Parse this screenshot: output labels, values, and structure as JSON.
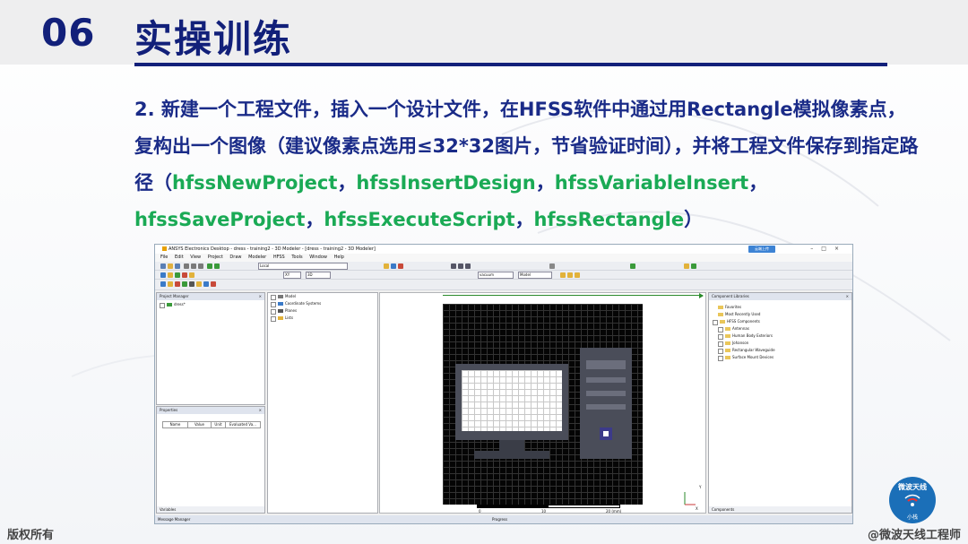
{
  "slide": {
    "section_number": "06",
    "section_title": "实操训练",
    "para_prefix": "2. 新建一个工程文件，插入一个设计文件，在HFSS软件中通过用Rectangle模拟像素点，复构出一个图像（建议像素点选用≤32*32图片，节省验证时间），并将工程文件保存到指定路径（",
    "functions": [
      "hfssNewProject",
      "hfssInsertDesign",
      "hfssVariableInsert",
      "hfssSaveProject",
      "hfssExecuteScript",
      "hfssRectangle"
    ],
    "sep1": "，",
    "sep2": "，",
    "sep3": "，",
    "sep4": "，",
    "sep5": "，",
    "para_suffix": "）",
    "footer_left": "版权所有",
    "footer_right": "@微波天线工程师",
    "badge_top": "微波天线",
    "badge_bottom": "小栈"
  },
  "window": {
    "title": "ANSYS Electronics Desktop - dress - training2 - 3D Modeler - [dress - training2 - 3D Modeler]",
    "cloud_button": "云端上传",
    "menu": [
      "File",
      "Edit",
      "View",
      "Project",
      "Draw",
      "Modeler",
      "HFSS",
      "Tools",
      "Window",
      "Help"
    ],
    "combos": {
      "material": "Local",
      "plane": "XY",
      "dim": "3D",
      "units": "vacuum",
      "mode": "Model"
    },
    "project_manager": {
      "title": "Project Manager",
      "root": "dress*"
    },
    "model_tree": [
      "Model",
      "Coordinate Systems",
      "Planes",
      "Lists"
    ],
    "properties": {
      "title": "Properties",
      "columns": [
        "Name",
        "Value",
        "Unit",
        "Evaluated Va..."
      ],
      "tab": "Variables"
    },
    "component_libraries": {
      "title": "Component Libraries",
      "items": [
        "Favorites",
        "Most Recently Used",
        "HFSS Components",
        "Antennas",
        "Human Body Exteriors",
        "Johanson",
        "Rectangular Waveguide",
        "Surface Mount Devices"
      ],
      "tab": "Components"
    },
    "scale_labels": [
      "0",
      "10",
      "20 (mm)"
    ],
    "axis_labels": {
      "x": "X",
      "y": "Y"
    },
    "message_manager": "Message Manager",
    "progress": "Progress"
  },
  "colors": {
    "navy": "#12207a",
    "green": "#1aaa55",
    "text_blue": "#1a2b88"
  }
}
